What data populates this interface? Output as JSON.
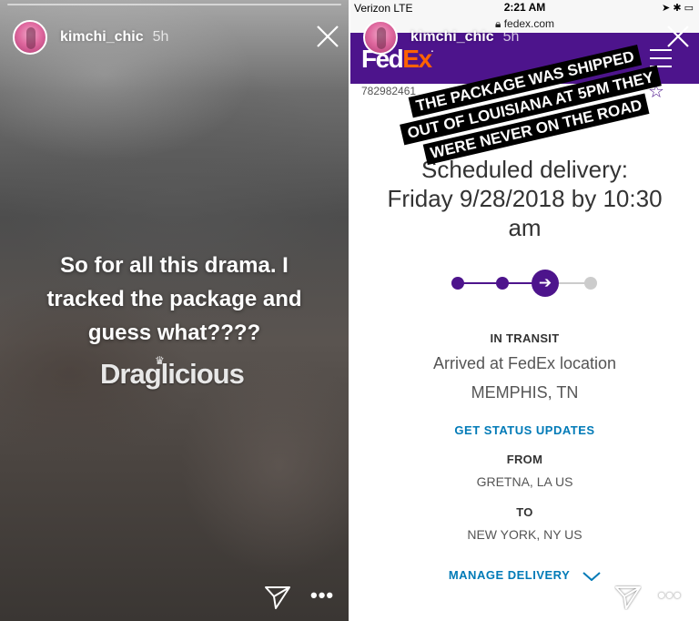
{
  "left_story": {
    "username": "kimchi_chic",
    "time": "5h",
    "caption_lines": [
      "So for all this drama. I",
      "tracked the package and",
      "guess what????"
    ],
    "watermark": "Draglicious"
  },
  "right_story": {
    "username": "kimchi_chic",
    "time": "5h",
    "status_bar": {
      "carrier": "Verizon  LTE",
      "clock": "2:21 AM"
    },
    "url": "fedex.com",
    "tracking_number": "782982461",
    "sticker_lines": [
      "THE PACKAGE WAS SHIPPED",
      "OUT OF LOUISIANA AT 5PM THEY",
      "WERE NEVER ON THE ROAD"
    ],
    "scheduled": {
      "heading": "Scheduled delivery:",
      "line2": "Friday 9/28/2018 by 10:30",
      "line3": "am"
    },
    "status_label": "IN TRANSIT",
    "location_line1": "Arrived at FedEx location",
    "location_line2": "MEMPHIS, TN",
    "status_link": "GET STATUS UPDATES",
    "from_label": "FROM",
    "from_value": "GRETNA, LA US",
    "to_label": "TO",
    "to_value": "NEW YORK, NY US",
    "manage_link": "MANAGE DELIVERY"
  },
  "colors": {
    "fedex_purple": "#4d148c",
    "fedex_orange": "#ff6200",
    "link_blue": "#007ab7"
  },
  "icons": [
    "close-icon",
    "send-icon",
    "more-icon",
    "star-icon",
    "menu-icon",
    "chevron-down-icon",
    "lock-icon"
  ]
}
